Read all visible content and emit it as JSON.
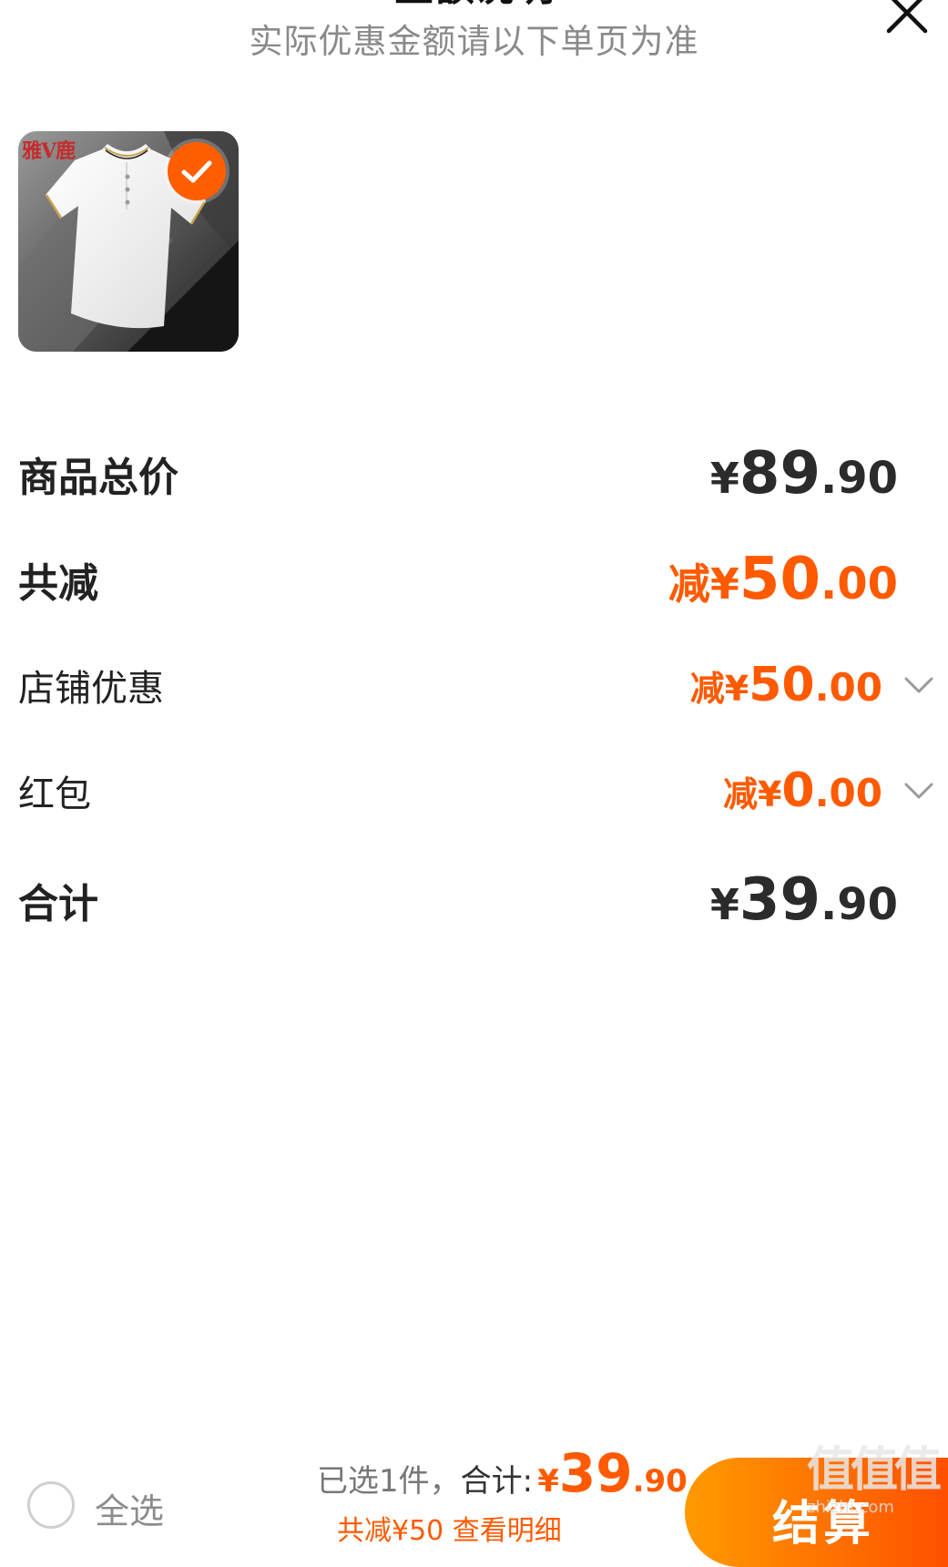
{
  "header": {
    "title": "金额说明",
    "subtitle": "实际优惠金额请以下单页为准",
    "close_icon": "close-icon"
  },
  "product": {
    "brand_logo": "雅V鹿",
    "image_icon": "white-polo-shirt-image",
    "selected": true
  },
  "rows": {
    "subtotal": {
      "label": "商品总价",
      "prefix": "¥",
      "int": "89",
      "dec": ".90"
    },
    "total_discount": {
      "label": "共减",
      "prefix": "减¥",
      "int": "50",
      "dec": ".00"
    },
    "store_discount": {
      "label": "店铺优惠",
      "prefix": "减¥",
      "int": "50",
      "dec": ".00",
      "icon": "chevron-down-icon"
    },
    "red_packet": {
      "label": "红包",
      "prefix": "减¥",
      "int": "0",
      "dec": ".00",
      "icon": "chevron-down-icon"
    },
    "total": {
      "label": "合计",
      "prefix": "¥",
      "int": "39",
      "dec": ".90"
    }
  },
  "bottom_bar": {
    "select_all_label": "全选",
    "selected_text": "已选1件，",
    "total_label": "合计:",
    "price_prefix": "¥",
    "price_int": "39",
    "price_dec": ".90",
    "discount_detail": "共减¥50  查看明细",
    "checkout_label": "结算"
  },
  "watermark": {
    "mark": "值值值",
    "url": "zhizhi.com"
  },
  "colors": {
    "accent": "#ff5a00",
    "checkout_gradient_start": "#ff9a00",
    "checkout_gradient_end": "#ff5000",
    "text_dark": "#222222",
    "text_muted": "#8a8a8a"
  }
}
